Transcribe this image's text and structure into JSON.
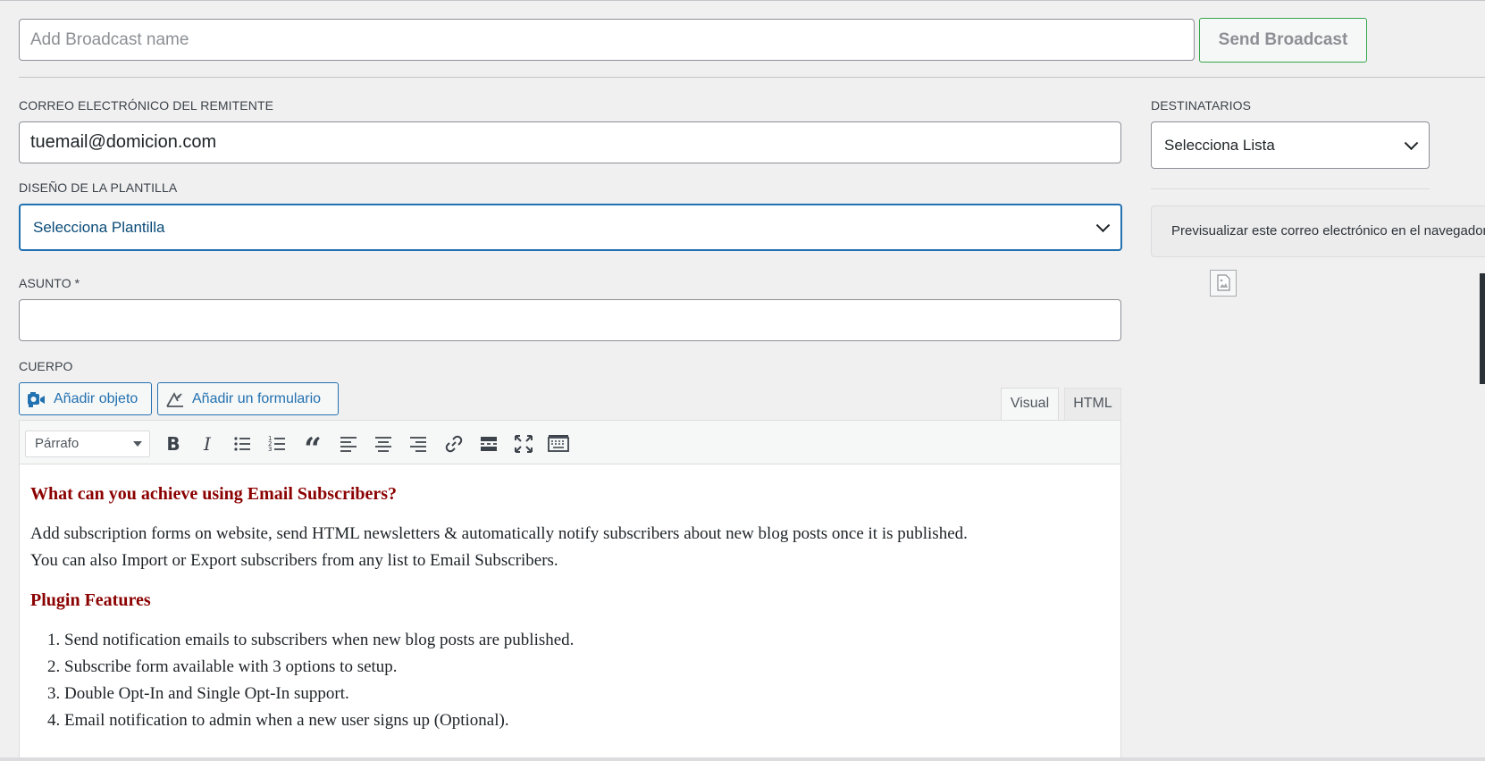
{
  "broadcast": {
    "name_placeholder": "Add Broadcast name",
    "send_label": "Send Broadcast"
  },
  "sender": {
    "label": "CORREO ELECTRÓNICO DEL REMITENTE",
    "value": "tuemail@domicion.com"
  },
  "template": {
    "label": "DISEÑO DE LA PLANTILLA",
    "selected": "Selecciona Plantilla"
  },
  "subject": {
    "label": "ASUNTO *",
    "value": ""
  },
  "body": {
    "label": "CUERPO",
    "add_media_label": "Añadir objeto",
    "add_form_label": "Añadir un formulario",
    "tabs": [
      "Visual",
      "HTML"
    ],
    "active_tab": "Visual",
    "format_selected": "Párrafo",
    "toolbar_icons": [
      "bold-icon",
      "italic-icon",
      "bullet-list-icon",
      "numbered-list-icon",
      "blockquote-icon",
      "align-left-icon",
      "align-center-icon",
      "align-right-icon",
      "link-icon",
      "read-more-icon",
      "fullscreen-icon",
      "toolbar-toggle-icon"
    ],
    "content": {
      "heading1": "What can you achieve using Email Subscribers?",
      "paragraph1_line1": "Add subscription forms on website, send HTML newsletters & automatically notify subscribers about new blog posts once it is published.",
      "paragraph1_line2": "You can also Import or Export subscribers from any list to Email Subscribers.",
      "heading2": "Plugin Features",
      "features": [
        "Send notification emails to subscribers when new blog posts are published.",
        "Subscribe form available with 3 options to setup.",
        "Double Opt-In and Single Opt-In support.",
        "Email notification to admin when a new user signs up (Optional)."
      ]
    }
  },
  "recipients": {
    "label": "DESTINATARIOS",
    "selected": "Selecciona Lista"
  },
  "preview": {
    "text": "Previsualizar este correo electrónico en el navegador"
  },
  "colors": {
    "accent": "#2271b1",
    "send_border": "#35a64c",
    "heading": "#8b0000"
  }
}
